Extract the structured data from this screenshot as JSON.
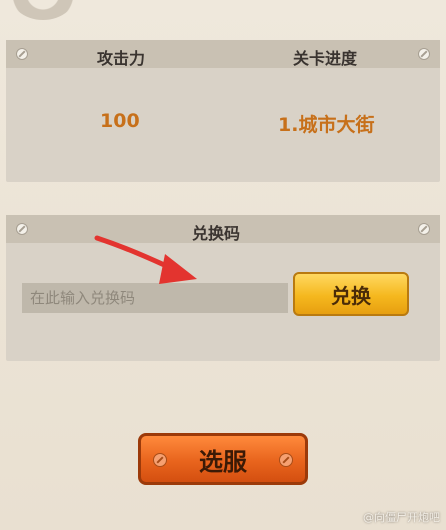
{
  "stats": {
    "attack_label": "攻击力",
    "level_label": "关卡进度",
    "attack_value": "100",
    "level_value": "1.城市大街"
  },
  "redeem": {
    "title": "兑换码",
    "placeholder": "在此输入兑换码",
    "button_label": "兑换"
  },
  "server_button_label": "选服",
  "watermark": "@向僵尸开炮吧",
  "colors": {
    "accent_orange": "#c7701a",
    "exchange_button": "#f5b81e",
    "server_button": "#e8641d",
    "arrow": "#e3342f"
  }
}
